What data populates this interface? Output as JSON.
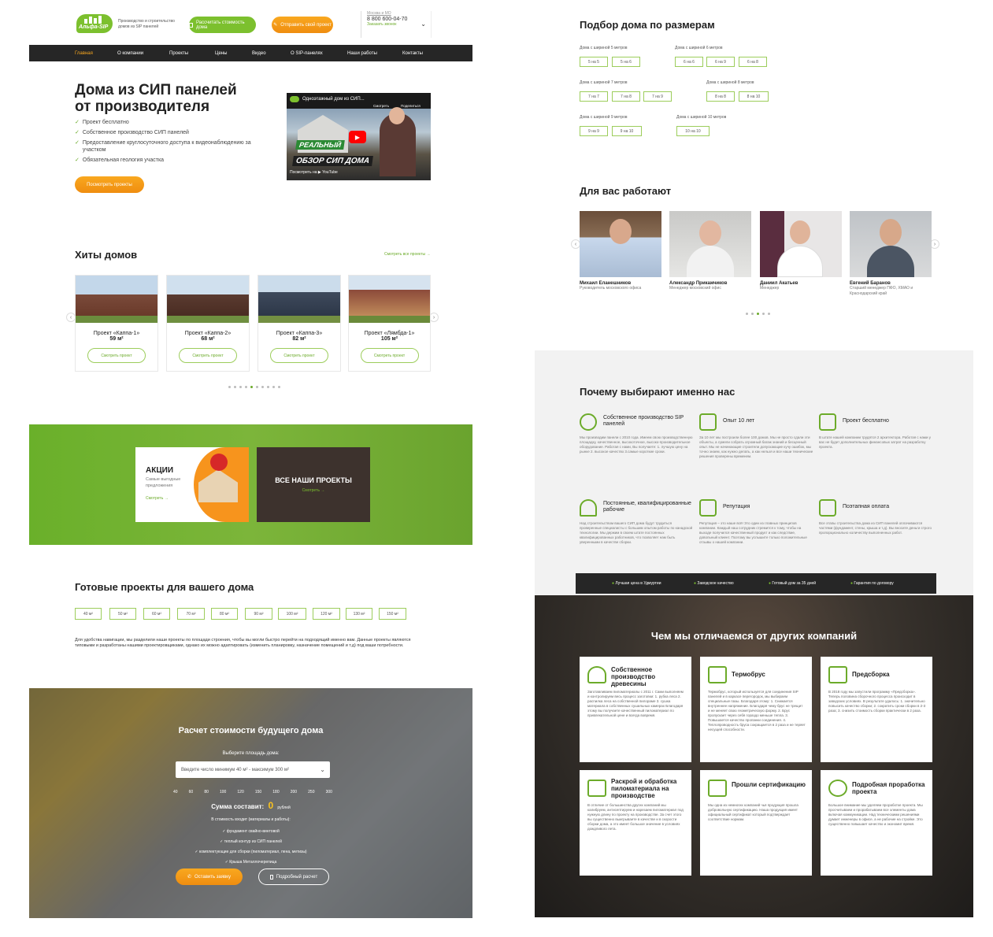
{
  "header": {
    "logo": "Альфа-SIP",
    "tagline": "Производство и строительство домов из SIP панелей",
    "calc_btn": "Рассчитать стоимость дома",
    "send_btn": "Отправить свой проект",
    "region": "Москва и МО",
    "phone": "8 800 600-04-70",
    "callback": "Заказать звонок"
  },
  "nav": [
    "Главная",
    "О компании",
    "Проекты",
    "Цены",
    "Видео",
    "О SIP-панелях",
    "Наши работы",
    "Контакты"
  ],
  "hero": {
    "title1": "Дома из СИП панелей",
    "title2": "от производителя",
    "points": [
      "Проект бесплатно",
      "Собственное производство СИП панелей",
      "Предоставление круглосуточного доступа к видеонаблюдению за участком",
      "Обязательная геология участка"
    ],
    "btn": "Посмотреть проекты",
    "video_title": "Одноэтажный дом из СИП...",
    "video_watch": "Смотреть",
    "video_share": "Поделиться",
    "video_big1": "РЕАЛЬНЫЙ",
    "video_big2": "ОБЗОР СИП ДОМА",
    "video_on": "Посмотреть на",
    "video_yt": "YouTube"
  },
  "hits": {
    "title": "Хиты домов",
    "all_link": "Смотреть все проекты →",
    "btn": "Смотреть проект",
    "items": [
      {
        "name": "Проект «Каппа-1»",
        "area": "59 м²"
      },
      {
        "name": "Проект «Каппа-2»",
        "area": "68 м²"
      },
      {
        "name": "Проект «Каппа-3»",
        "area": "82 м²"
      },
      {
        "name": "Проект «Лямбда-1»",
        "area": "105 м²"
      }
    ]
  },
  "promo": {
    "title": "АКЦИИ",
    "sub": "Самые выгодные предложения",
    "link": "Смотреть →",
    "all": "ВСЕ НАШИ ПРОЕКТЫ",
    "all_link": "Смотреть →"
  },
  "ready": {
    "title": "Готовые проекты для вашего дома",
    "chips": [
      "40 м²",
      "50 м²",
      "60 м²",
      "70 м²",
      "80 м²",
      "90 м²",
      "100 м²",
      "120 м²",
      "130 м²",
      "150 м²"
    ],
    "desc": "Для удобства навигации, мы разделили наши проекты по площади строения, чтобы вы могли быстро перейти на подходящий именно вам. Данные проекты являются типовыми и разработаны нашими проектировщиками, однако их можно адаптировать (изменить планировку, назначение помещений и т.д) под ваши потребности."
  },
  "calc": {
    "title": "Расчет стоимости будущего дома",
    "label": "Выберите площадь дома:",
    "placeholder": "Введите число минимум 40 м² - максимум 300 м²",
    "scale": [
      "40",
      "60",
      "80",
      "100",
      "120",
      "150",
      "180",
      "200",
      "250",
      "300"
    ],
    "sum_label": "Сумма составит:",
    "sum": "0",
    "currency": "рублей",
    "includes": "В стоимость входит (материалы и работы):",
    "items": [
      "✓ фундамент свайно-винтовой",
      "✓ теплый контур из СИП панелей",
      "✓ комплектующие для сборки (пиломатериал, пена, метизы)",
      "✓ Крыша Металлочерепица"
    ],
    "btn_req": "Оставить заявку",
    "btn_calc": "Подробный расчет"
  },
  "sizes": {
    "title": "Подбор дома по размерам",
    "groups": [
      {
        "label": "Дома с шириной 5 метров",
        "chips": [
          "5 на 5",
          "5 на 6"
        ]
      },
      {
        "label": "Дома с шириной 6 метров",
        "chips": [
          "6 на 6",
          "6 на 9",
          "6 на 8"
        ]
      },
      {
        "label": "Дома с шириной 7 метров",
        "chips": [
          "7 на 7",
          "7 на 8",
          "7 на 9"
        ]
      },
      {
        "label": "Дома с шириной 8 метров",
        "chips": [
          "8 на 8",
          "8 на 10"
        ]
      },
      {
        "label": "Дома с шириной 9 метров",
        "chips": [
          "9 на 9",
          "9 на 10"
        ]
      },
      {
        "label": "Дома с шириной 10 метров",
        "chips": [
          "10 на 10"
        ]
      }
    ]
  },
  "team": {
    "title": "Для вас работают",
    "people": [
      {
        "name": "Михаил Еланешников",
        "role": "Руководитель московского офиса"
      },
      {
        "name": "Александр Прикажчиков",
        "role": "Менеджер московский офис"
      },
      {
        "name": "Даниил Акатьев",
        "role": "Менеджер"
      },
      {
        "name": "Евгений Баранов",
        "role": "Старший менеджер ПФО, ХМАО и Краснодарский край"
      }
    ]
  },
  "why": {
    "title": "Почему выбирают именно нас",
    "items": [
      {
        "t": "Собственное производство SIP панелей",
        "d": "Мы производим панели с 2010 года. Имеем свою производственную площадку, качественное, высокоточное, высоко-производительное оборудование. Работая с нами, Вы получаете: 1. лучшую цену на рынке 2. высокое качество 3.самые короткие сроки."
      },
      {
        "t": "Опыт 10 лет",
        "d": "За 10 лет мы построили более 100 домов. Мы не просто сдали эти объекты, а сумели собрать огромный багаж знаний и бесценный опыт. Мы не начинающие строители допускающие кучу ошибок, мы точно знаем, как нужно делать, а как нельзя и все наши технические решения проверены временем."
      },
      {
        "t": "Проект бесплатно",
        "d": "В штате нашей компании трудятся 2 архитектора. Работая с нами у вас не будет дополнительных финансовых затрат на разработку проекта."
      },
      {
        "t": "Постоянные, квалифицированные рабочие",
        "d": "Над строительством вашего СИП дома будут трудиться проверенные специалисты с большим опытом работы по канадской технологии. Мы держим в своем штате постоянных квалифицированных работников, что позволяет нам быть уверенными в качестве сборки."
      },
      {
        "t": "Репутация",
        "d": "Репутация – это наше всё! Это один из главных принципов компании. Каждый наш сотрудник стремится к тому, чтобы на выходе получился качественный продукт и как следствие, довольный клиент. Поэтому вы услышите только положительные отзывы о нашей компании."
      },
      {
        "t": "Поэтапная оплата",
        "d": "Все этапы строительства дома из СИП панелей оплачиваются частями (фундамент, стены, крыша и т.д). Вы вносите деньги строго пропорционально количеству выполненных работ."
      }
    ],
    "bar": [
      "Лучшая цена в Удмуртии",
      "Заводское качество",
      "Готовый дом за 35 дней",
      "Гарантия по договору"
    ]
  },
  "diff": {
    "title": "Чем мы отличаемся от других компаний",
    "items": [
      {
        "t": "Собственное производство древесины",
        "d": "Заготавливаем пиломатериалы с 2011 г. Сами выполняем и контролируем весь процесс заготовки: 1. рубка леса 2. распилка леса на собственной пилораме 3. сушка материала в собственных сушильных камерах Благодаря этому вы получаете качественный пиломатериал по привлекательной цене и всегда вовремя."
      },
      {
        "t": "Термобрус",
        "d": "Термобрус, который используется для соединения SIP панелей и в каркасе перегородок, мы выбираем специальные пазы. Благодаря этому: 1. Снижается внутреннее напряжение. Благодаря чему брус не трещит и не меняет свою геометрическую форму. 2. Брус пропускает через себя гораздо меньше тепла. 3. Повышается качество пропанки соединения. 4. Теплопроводность бруса сокращается в 2 раза и не теряет несущей способности."
      },
      {
        "t": "Предсборка",
        "d": "В 2018 году мы запустили программу «Предсборка». Теперь половина сборочного процесса происходит в заводских условиях. В результате удалось: 1. значительно повысить качество сборки; 2. сократить сроки сборки в 2-3 раза; 3. снизить стоимость сборки практически в 2 раза."
      },
      {
        "t": "Раскрой и обработка пиломатериала на производстве",
        "d": "В отличие от большинства других компаний мы калибруем, антисептируем и нарезаем пиломатериал под нужную длину по проекту на производстве. За счет этого вы существенно выигрываете в качестве и в скорости сборки дома, а это имеет большое значение в условиях дождливого лета."
      },
      {
        "t": "Прошли сертификацию",
        "d": "Мы одна из немногих компаний чья продукция прошла добровольную сертификацию. Наша продукция имеет официальный сертификат который подтверждает соответствие нормам."
      },
      {
        "t": "Подробная проработка проекта",
        "d": "Большое внимание мы уделяем проработке проекта. Мы просчитываем и прорабатываем все элементы дома включая коммуникации. Над техническими решениями думает инженеры в офисе, а не рабочие на стройке. Это существенно повышает качество и экономит время."
      }
    ]
  }
}
